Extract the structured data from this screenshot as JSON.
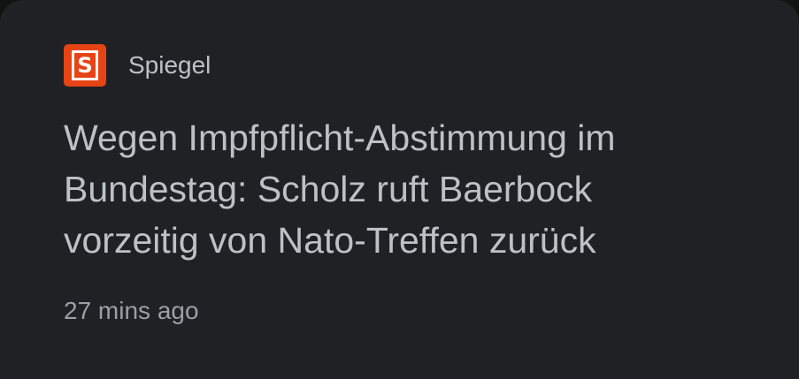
{
  "source": {
    "logo_letter": "S",
    "name": "Spiegel",
    "logo_color": "#e64415"
  },
  "article": {
    "headline": "Wegen Impfpflicht-Abstimmung im\nBundestag: Scholz ruft Baerbock\nvorzeitig von Nato-Treffen zurück",
    "timestamp": "27 mins ago"
  },
  "colors": {
    "card_background": "#202124",
    "text_primary": "#bdc1c6",
    "text_secondary": "#9aa0a6"
  }
}
